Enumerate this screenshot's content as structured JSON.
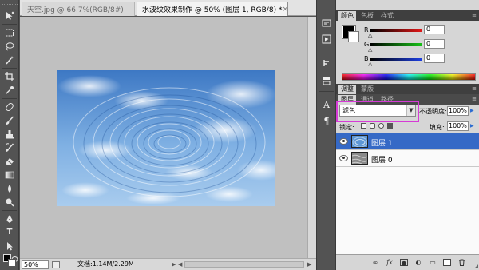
{
  "tools": [
    {
      "icon": "move-icon"
    },
    {
      "icon": "rect-marquee-icon"
    },
    {
      "icon": "lasso-icon"
    },
    {
      "icon": "magic-wand-icon"
    },
    {
      "icon": "crop-icon"
    },
    {
      "icon": "eyedropper-icon"
    },
    {
      "icon": "healing-brush-icon"
    },
    {
      "icon": "brush-icon"
    },
    {
      "icon": "clone-stamp-icon"
    },
    {
      "icon": "history-brush-icon"
    },
    {
      "icon": "eraser-icon"
    },
    {
      "icon": "gradient-icon"
    },
    {
      "icon": "blur-icon"
    },
    {
      "icon": "dodge-icon"
    },
    {
      "icon": "pen-icon"
    },
    {
      "icon": "type-icon",
      "glyph": "T"
    },
    {
      "icon": "path-select-icon"
    },
    {
      "icon": "shape-icon"
    },
    {
      "icon": "hand-icon"
    },
    {
      "icon": "zoom-icon"
    }
  ],
  "document_tabs": [
    {
      "title": "天空.jpg @ 66.7%(RGB/8#)",
      "active": false
    },
    {
      "title": "水波纹效果制作 @ 50% (图层 1, RGB/8) *",
      "active": true
    }
  ],
  "status": {
    "zoom": "50%",
    "doc_info": "文档:1.14M/2.29M"
  },
  "dock_icons": [
    {
      "icon": "history-icon"
    },
    {
      "icon": "actions-play-icon"
    },
    {
      "icon": "navigator-icon"
    },
    {
      "icon": "tool-presets-icon"
    },
    {
      "icon": "character-icon",
      "glyph": "A"
    },
    {
      "icon": "paragraph-icon",
      "glyph": "¶"
    }
  ],
  "color_panel": {
    "tabs": [
      "颜色",
      "色板",
      "样式"
    ],
    "channels": [
      {
        "label": "R",
        "value": "0",
        "color": "#e01818"
      },
      {
        "label": "G",
        "value": "0",
        "color": "#18c018"
      },
      {
        "label": "B",
        "value": "0",
        "color": "#1d3fe0"
      }
    ],
    "foreground": "#000000",
    "background": "#ffffff"
  },
  "adjust_tabs": [
    "调整",
    "蒙版"
  ],
  "layers_panel": {
    "tabs": [
      "图层",
      "通道",
      "路径"
    ],
    "blend_mode": "滤色",
    "highlight_color": "#d63bd6",
    "opacity_label": "不透明度:",
    "opacity_value": "100%",
    "lock_label": "锁定:",
    "fill_label": "填充:",
    "fill_value": "100%",
    "layers": [
      {
        "name": "图层 1",
        "selected": true
      },
      {
        "name": "图层 0",
        "selected": false
      }
    ],
    "footer_icons": [
      {
        "icon": "link-layers-icon"
      },
      {
        "icon": "fx-icon",
        "glyph": "fx"
      },
      {
        "icon": "add-mask-icon"
      },
      {
        "icon": "adjustment-layer-icon"
      },
      {
        "icon": "new-group-icon"
      },
      {
        "icon": "new-layer-icon"
      },
      {
        "icon": "delete-layer-icon"
      }
    ]
  },
  "theme": {
    "ui_dark": "#535353",
    "canvas_gray": "#c0c0c0",
    "selection_blue": "#3569c6"
  }
}
